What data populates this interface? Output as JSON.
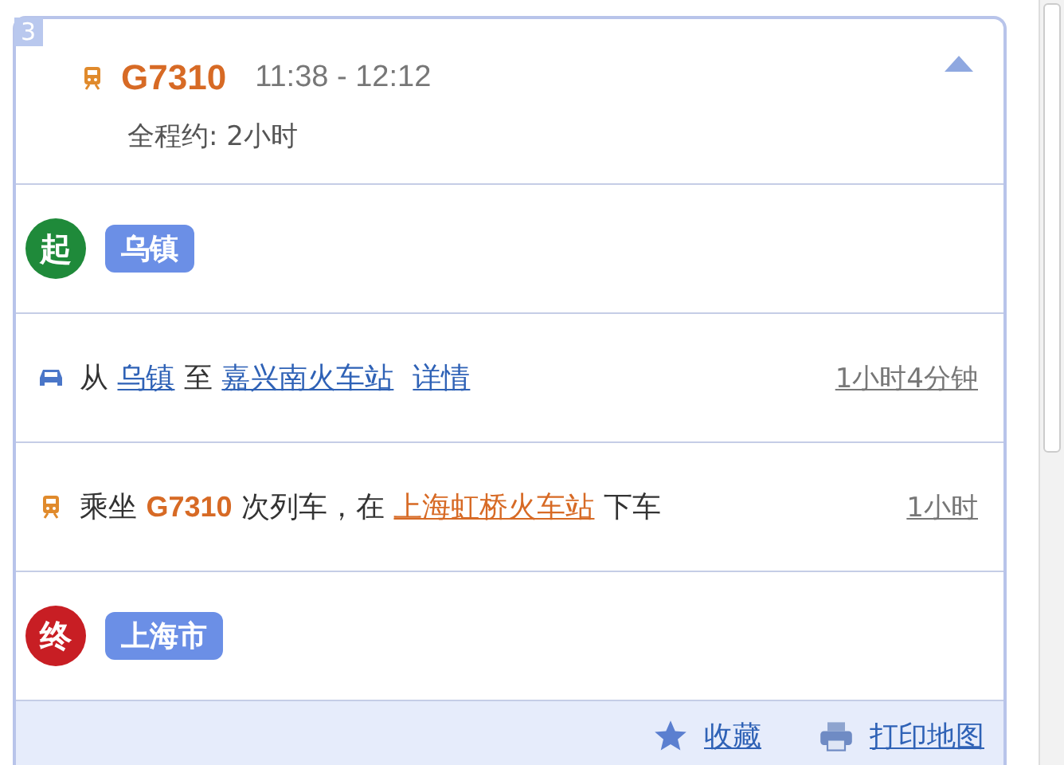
{
  "plan": {
    "index": "3",
    "expanded": true,
    "train": "G7310",
    "time": "11:38 - 12:12",
    "total": "全程约: 2小时"
  },
  "stops": [
    {
      "kind": "start",
      "marker": "起",
      "name": "乌镇"
    },
    {
      "kind": "end",
      "marker": "终",
      "name": "上海市"
    }
  ],
  "steps": [
    {
      "kind": "car",
      "parts": [
        {
          "kind": "text",
          "text": "从 "
        },
        {
          "kind": "link",
          "text": "乌镇"
        },
        {
          "kind": "text",
          "text": " 至 "
        },
        {
          "kind": "link",
          "text": "嘉兴南火车站"
        },
        {
          "kind": "link",
          "text": "详情"
        }
      ],
      "duration": "1小时4分钟"
    },
    {
      "kind": "train",
      "parts": [
        {
          "kind": "text",
          "text": "乘坐 "
        },
        {
          "kind": "train",
          "text": "G7310"
        },
        {
          "kind": "text",
          "text": " 次列车，在 "
        },
        {
          "kind": "orange-link",
          "text": "上海虹桥火车站"
        },
        {
          "kind": "text",
          "text": " 下车"
        }
      ],
      "duration": "1小时"
    }
  ],
  "actions": [
    {
      "kind": "star",
      "label": "收藏"
    },
    {
      "kind": "print",
      "label": "打印地图"
    }
  ]
}
